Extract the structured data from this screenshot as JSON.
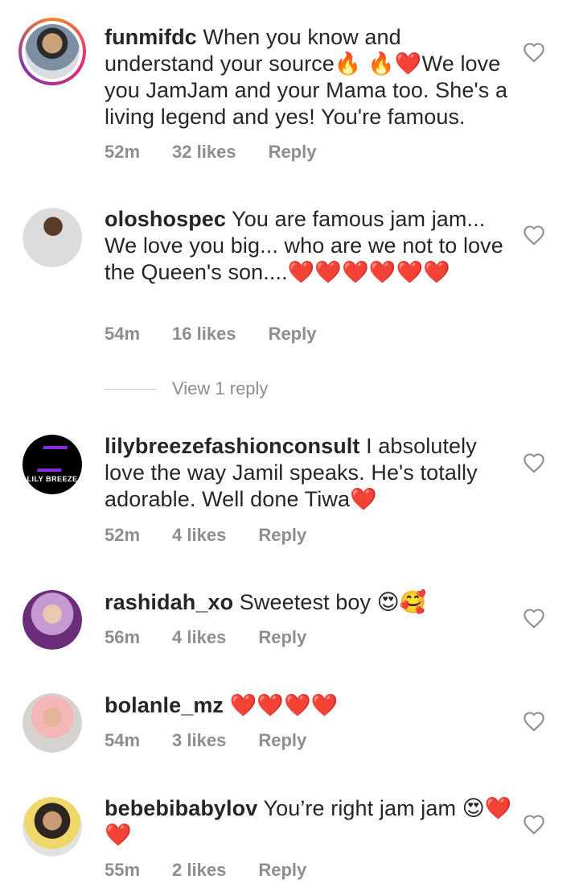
{
  "comments": [
    {
      "username": "funmifdc",
      "text": "When you know and understand your source🔥 🔥❤️We love you JamJam and your Mama too. She's a living legend and yes! You're famous.",
      "time": "52m",
      "likes": "32 likes",
      "reply": "Reply"
    },
    {
      "username": "oloshospec",
      "text": "You are famous  jam jam... We love you big... who are we not to love the Queen's  son....❤️❤️❤️❤️❤️❤️",
      "time": "54m",
      "likes": "16 likes",
      "reply": "Reply"
    },
    {
      "username": "lilybreezefashionconsult",
      "text": "I absolutely love the way Jamil speaks. He's totally adorable. Well done Tiwa❤️",
      "time": "52m",
      "likes": "4 likes",
      "reply": "Reply",
      "avatar_text": "LILY BREEZE"
    },
    {
      "username": "rashidah_xo",
      "text": "Sweetest boy 😍🥰",
      "time": "56m",
      "likes": "4 likes",
      "reply": "Reply"
    },
    {
      "username": "bolanle_mz",
      "text": "❤️❤️❤️❤️",
      "time": "54m",
      "likes": "3 likes",
      "reply": "Reply"
    },
    {
      "username": "bebebibabylov",
      "text": "You’re right jam jam 😍❤️❤️",
      "time": "55m",
      "likes": "2 likes",
      "reply": "Reply"
    }
  ],
  "view_replies": "View 1 reply",
  "colors": {
    "text": "#262626",
    "meta": "#8e8e8e",
    "heart_outline": "#8e8e8e"
  }
}
